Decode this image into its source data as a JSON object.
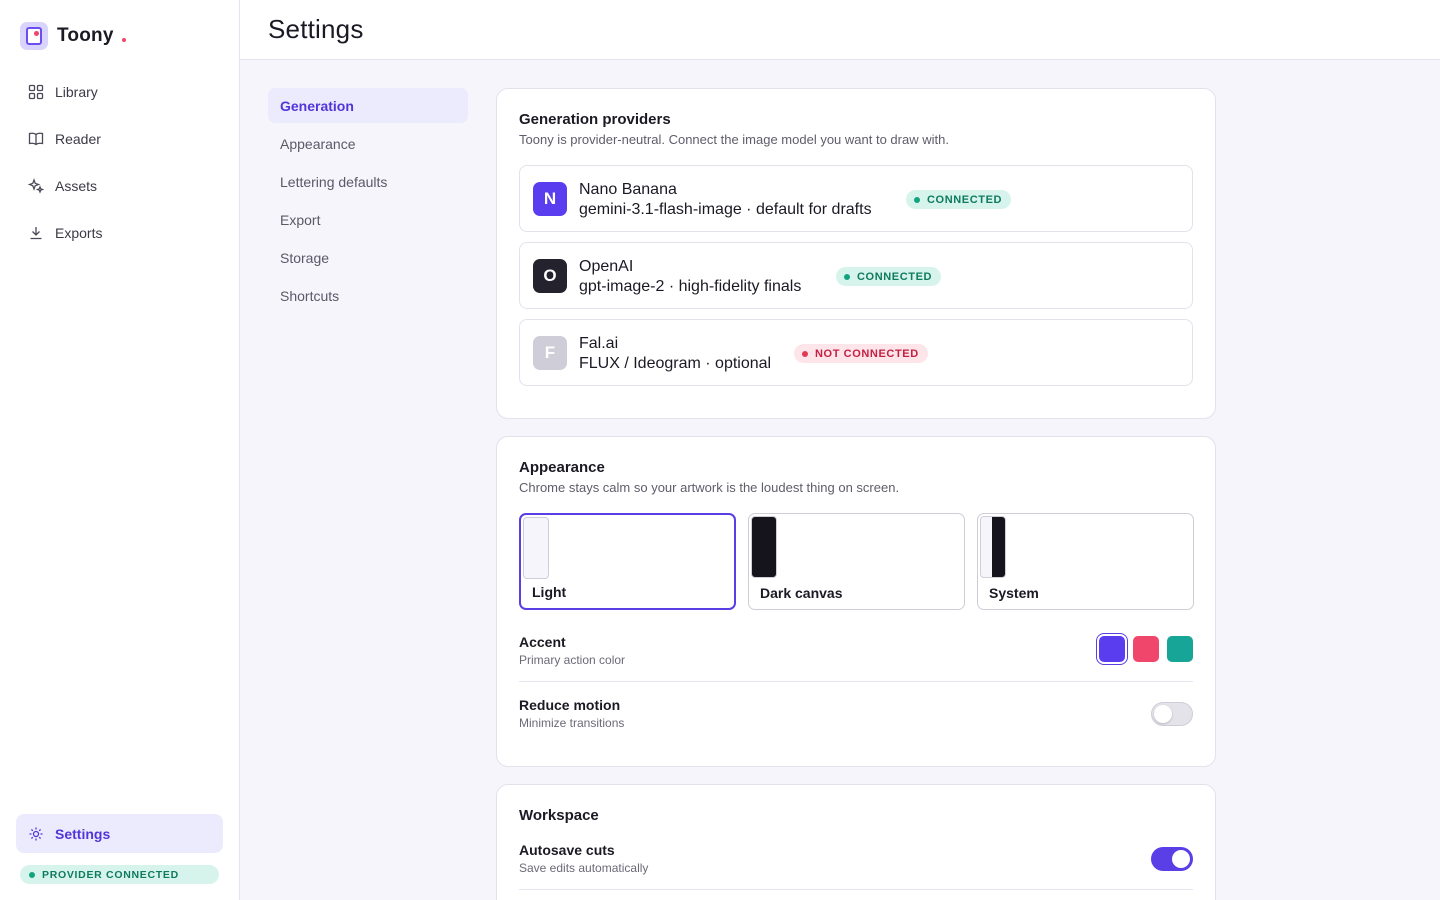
{
  "app": {
    "name": "Toony"
  },
  "sidebar": {
    "items": [
      {
        "label": "Library",
        "icon": "grid-icon"
      },
      {
        "label": "Reader",
        "icon": "book-icon"
      },
      {
        "label": "Assets",
        "icon": "sparkle-icon"
      },
      {
        "label": "Exports",
        "icon": "download-icon"
      }
    ],
    "settings_label": "Settings",
    "provider_status": "PROVIDER CONNECTED"
  },
  "header": {
    "title": "Settings"
  },
  "subnav": {
    "items": [
      "Generation",
      "Appearance",
      "Lettering defaults",
      "Export",
      "Storage",
      "Shortcuts"
    ],
    "active": "Generation"
  },
  "generation": {
    "title": "Generation providers",
    "description": "Toony is provider-neutral. Connect the image model you want to draw with.",
    "providers": [
      {
        "initial": "N",
        "name": "Nano Banana",
        "detail": "gemini-3.1-flash-image · default for drafts",
        "status": "CONNECTED",
        "color": "#5b3df0"
      },
      {
        "initial": "O",
        "name": "OpenAI",
        "detail": "gpt-image-2 · high-fidelity finals",
        "status": "CONNECTED",
        "color": "#24232d"
      },
      {
        "initial": "F",
        "name": "Fal.ai",
        "detail": "FLUX / Ideogram · optional",
        "status": "NOT CONNECTED",
        "color": "#cfcdd8"
      }
    ]
  },
  "appearance": {
    "title": "Appearance",
    "description": "Chrome stays calm so your artwork is the loudest thing on screen.",
    "themes": [
      "Light",
      "Dark canvas",
      "System"
    ],
    "selected_theme": "Light",
    "accent": {
      "title": "Accent",
      "subtitle": "Primary action color",
      "colors": [
        "#5b3df0",
        "#f0466b",
        "#16a596"
      ]
    },
    "reduce_motion": {
      "title": "Reduce motion",
      "subtitle": "Minimize transitions",
      "enabled": false
    }
  },
  "workspace": {
    "title": "Workspace",
    "autosave": {
      "title": "Autosave cuts",
      "subtitle": "Save edits automatically",
      "enabled": true
    }
  }
}
